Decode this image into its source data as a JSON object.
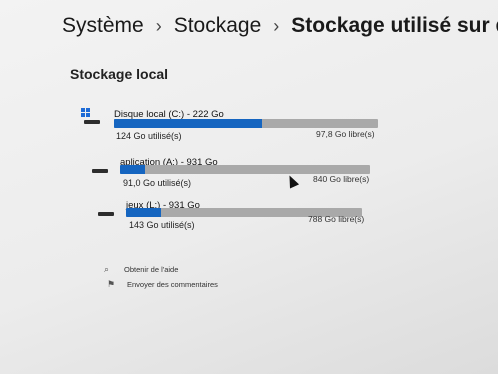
{
  "breadcrumb": {
    "items": [
      "Système",
      "Stockage",
      "Stockage utilisé sur d'a"
    ]
  },
  "section_title": "Stockage local",
  "drives": [
    {
      "name": "Disque local (C:) - 222 Go",
      "used": "124 Go utilisé(s)",
      "free": "97,8 Go libre(s)",
      "used_fraction": 0.56,
      "icon": "windows-drive-icon"
    },
    {
      "name": "aplication (A:) - 931 Go",
      "used": "91,0 Go utilisé(s)",
      "free": "840 Go libre(s)",
      "used_fraction": 0.1,
      "icon": "hard-drive-icon"
    },
    {
      "name": "jeux (L:) - 931 Go",
      "used": "143 Go utilisé(s)",
      "free": "788 Go libre(s)",
      "used_fraction": 0.15,
      "icon": "hard-drive-icon"
    }
  ],
  "links": {
    "help": "Obtenir de l'aide",
    "feedback": "Envoyer des commentaires"
  },
  "colors": {
    "accent": "#1565c0",
    "bar_track": "#a9a9a9"
  }
}
